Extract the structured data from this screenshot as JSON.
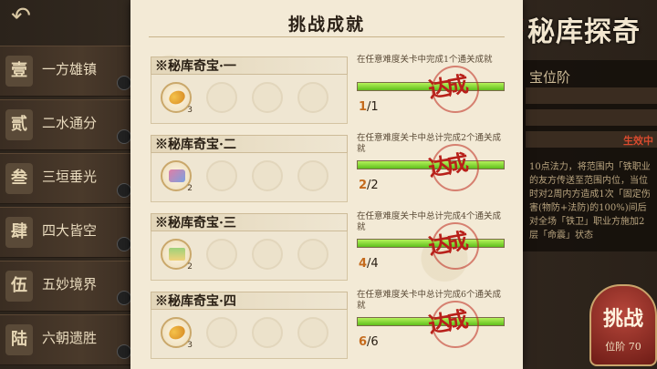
{
  "background": {
    "left_menu": [
      "一方雄镇",
      "二水通分",
      "三垣垂光",
      "四大皆空",
      "五妙境界",
      "六朝遗胜"
    ],
    "left_badges": [
      "壹",
      "贰",
      "叁",
      "肆",
      "伍",
      "陆"
    ],
    "right_title": "秘库探奇",
    "right_head": "宝位阶",
    "status_active": "生效中",
    "right_desc": "10点法力，将范围内「铁职业的友方传送至范围内位，当位时对2周内方造成1次「固定伤害(物防+法防)的100%)间后对全场「铁卫」职业方施加2层「命震」状态",
    "challenge_button": "挑战",
    "challenge_level": "位阶 70"
  },
  "modal": {
    "title": "挑战成就",
    "stamp_text": "达成",
    "achievements": [
      {
        "name": "※秘库奇宝·一",
        "desc": "在任意难度关卡中完成1个通关成就",
        "current": "1",
        "total": "/1",
        "progress": 1.0,
        "reward_count": "3",
        "reward_icon": "egg"
      },
      {
        "name": "※秘库奇宝·二",
        "desc": "在任意难度关卡中总计完成2个通关成就",
        "current": "2",
        "total": "/2",
        "progress": 1.0,
        "reward_count": "2",
        "reward_icon": "cube"
      },
      {
        "name": "※秘库奇宝·三",
        "desc": "在任意难度关卡中总计完成4个通关成就",
        "current": "4",
        "total": "/4",
        "progress": 1.0,
        "reward_count": "2",
        "reward_icon": "house"
      },
      {
        "name": "※秘库奇宝·四",
        "desc": "在任意难度关卡中总计完成6个通关成就",
        "current": "6",
        "total": "/6",
        "progress": 1.0,
        "reward_count": "3",
        "reward_icon": "egg"
      }
    ]
  },
  "colors": {
    "accent": "#c46a1c",
    "bar_fill": "#7fd22e",
    "stamp": "#b8201a"
  }
}
